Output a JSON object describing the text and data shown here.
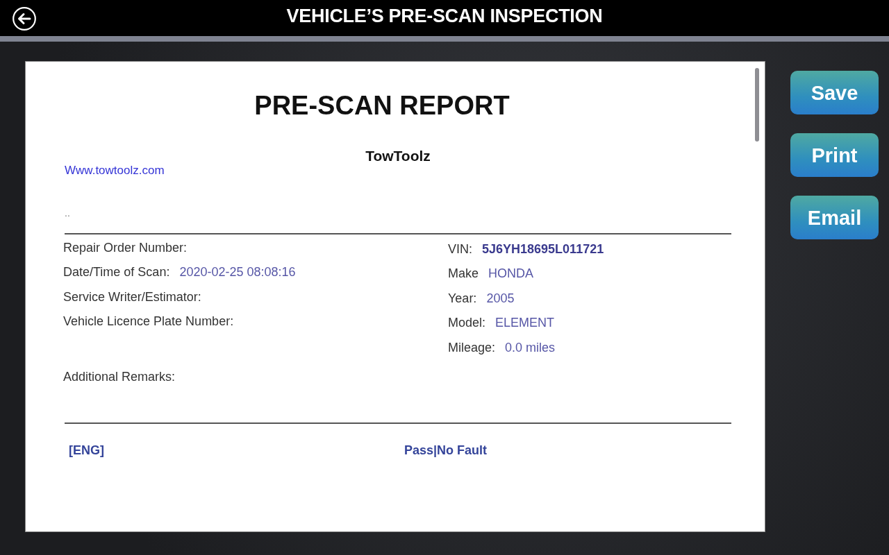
{
  "header": {
    "title": "VEHICLE’S PRE-SCAN INSPECTION"
  },
  "report": {
    "title": "PRE-SCAN REPORT",
    "company": "TowToolz",
    "website": "Www.towtoolz.com",
    "note": "..",
    "left_fields": [
      {
        "label": "Repair Order Number:"
      },
      {
        "label": "Date/Time of Scan:",
        "value": "2020-02-25 08:08:16"
      },
      {
        "label": "Service Writer/Estimator:"
      },
      {
        "label": "Vehicle Licence Plate Number:"
      }
    ],
    "right_fields": [
      {
        "label": "VIN:",
        "value": "5J6YH18695L011721",
        "emphasized": true
      },
      {
        "label": "Make",
        "value": "HONDA",
        "emphasized": false
      },
      {
        "label": "Year:",
        "value": "2005",
        "emphasized": false
      },
      {
        "label": "Model:",
        "value": "ELEMENT",
        "emphasized": false
      },
      {
        "label": "Mileage:",
        "value": "0.0 miles",
        "emphasized": false
      }
    ],
    "remarks_label": "Additional Remarks:",
    "results": [
      {
        "system": "[ENG]",
        "status": "Pass|No Fault"
      }
    ]
  },
  "actions": [
    {
      "label": "Save"
    },
    {
      "label": "Print"
    },
    {
      "label": "Email"
    }
  ]
}
